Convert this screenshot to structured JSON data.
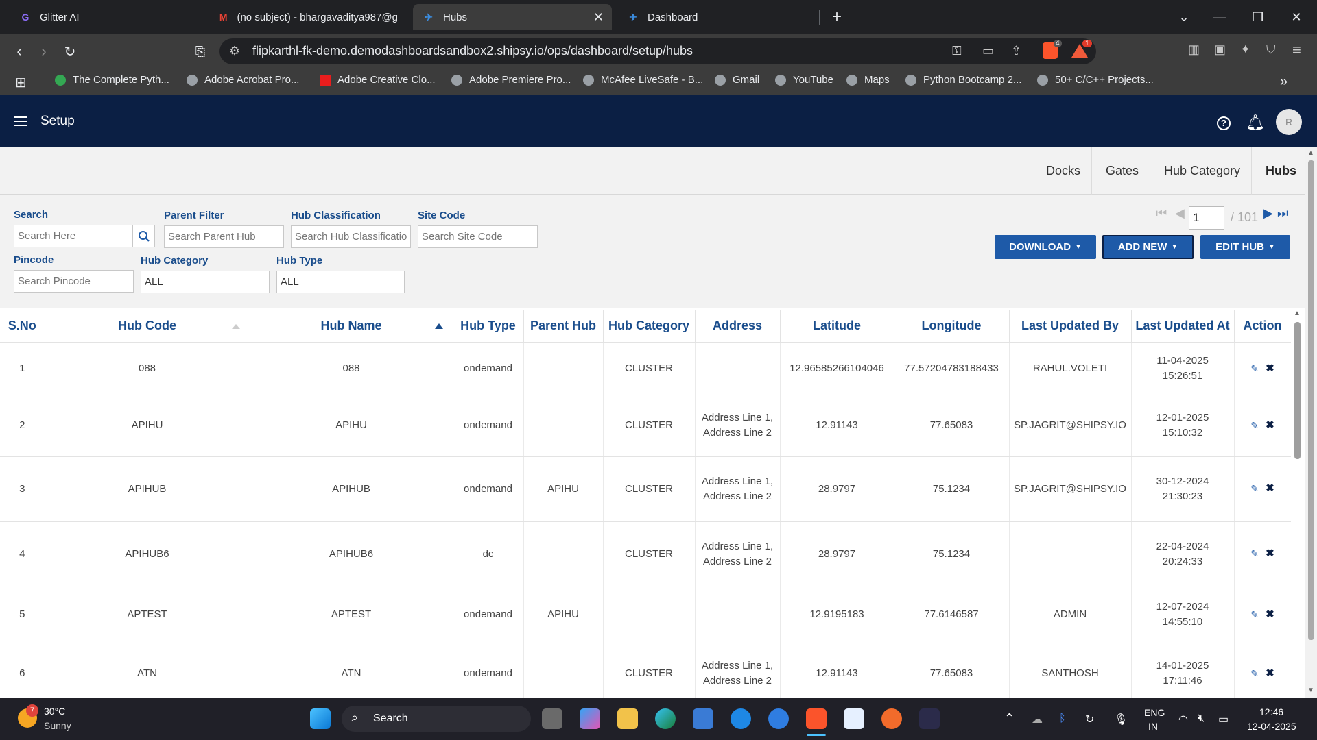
{
  "browser": {
    "tabs": [
      {
        "title": "Glitter AI"
      },
      {
        "title": "(no subject) - bhargavaditya987@g"
      },
      {
        "title": "Hubs"
      },
      {
        "title": "Dashboard"
      }
    ],
    "url": "flipkarthl-fk-demo.demodashboardsandbox2.shipsy.io/ops/dashboard/setup/hubs",
    "brave_badge": "4",
    "alert_badge": "1",
    "bookmarks": [
      "The Complete Pyth...",
      "Adobe Acrobat Pro...",
      "Adobe Creative Clo...",
      "Adobe Premiere Pro...",
      "McAfee LiveSafe - B...",
      "Gmail",
      "YouTube",
      "Maps",
      "Python Bootcamp 2...",
      "50+ C/C++ Projects..."
    ]
  },
  "app": {
    "title": "Setup",
    "avatar_initial": "R",
    "subtabs": [
      "Docks",
      "Gates",
      "Hub Category",
      "Hubs"
    ],
    "active_subtab": "Hubs"
  },
  "filters": {
    "search_label": "Search",
    "search_placeholder": "Search Here",
    "parent_label": "Parent Filter",
    "parent_placeholder": "Search Parent Hub",
    "classification_label": "Hub Classification",
    "classification_placeholder": "Search Hub Classificatio",
    "sitecode_label": "Site Code",
    "sitecode_placeholder": "Search Site Code",
    "pincode_label": "Pincode",
    "pincode_placeholder": "Search Pincode",
    "category_label": "Hub Category",
    "category_value": "ALL",
    "type_label": "Hub Type",
    "type_value": "ALL"
  },
  "pager": {
    "page": "1",
    "total": "/ 101"
  },
  "actions": {
    "download": "DOWNLOAD",
    "add_new": "ADD NEW",
    "edit_hub": "EDIT HUB"
  },
  "table": {
    "columns": [
      "S.No",
      "Hub Code",
      "Hub Name",
      "Hub Type",
      "Parent Hub",
      "Hub Category",
      "Address",
      "Latitude",
      "Longitude",
      "Last Updated By",
      "Last Updated At",
      "Action"
    ],
    "rows": [
      {
        "sno": "1",
        "code": "088",
        "name": "088",
        "type": "ondemand",
        "parent": "",
        "category": "CLUSTER",
        "address": "",
        "lat": "12.96585266104046",
        "lng": "77.57204783188433",
        "by": "RAHUL.VOLETI",
        "date": "11-04-2025",
        "time": "15:26:51"
      },
      {
        "sno": "2",
        "code": "APIHU",
        "name": "APIHU",
        "type": "ondemand",
        "parent": "",
        "category": "CLUSTER",
        "address": "Address Line 1, Address Line 2",
        "lat": "12.91143",
        "lng": "77.65083",
        "by": "SP.JAGRIT@SHIPSY.IO",
        "date": "12-01-2025",
        "time": "15:10:32"
      },
      {
        "sno": "3",
        "code": "APIHUB",
        "name": "APIHUB",
        "type": "ondemand",
        "parent": "APIHU",
        "category": "CLUSTER",
        "address": "Address Line 1, Address Line 2",
        "lat": "28.9797",
        "lng": "75.1234",
        "by": "SP.JAGRIT@SHIPSY.IO",
        "date": "30-12-2024",
        "time": "21:30:23"
      },
      {
        "sno": "4",
        "code": "APIHUB6",
        "name": "APIHUB6",
        "type": "dc",
        "parent": "",
        "category": "CLUSTER",
        "address": "Address Line 1, Address Line 2",
        "lat": "28.9797",
        "lng": "75.1234",
        "by": "",
        "date": "22-04-2024",
        "time": "20:24:33"
      },
      {
        "sno": "5",
        "code": "APTEST",
        "name": "APTEST",
        "type": "ondemand",
        "parent": "APIHU",
        "category": "",
        "address": "",
        "lat": "12.9195183",
        "lng": "77.6146587",
        "by": "ADMIN",
        "date": "12-07-2024",
        "time": "14:55:10"
      },
      {
        "sno": "6",
        "code": "ATN",
        "name": "ATN",
        "type": "ondemand",
        "parent": "",
        "category": "CLUSTER",
        "address": "Address Line 1, Address Line 2",
        "lat": "12.91143",
        "lng": "77.65083",
        "by": "SANTHOSH",
        "date": "14-01-2025",
        "time": "17:11:46"
      }
    ]
  },
  "taskbar": {
    "weather_temp": "30°C",
    "weather_desc": "Sunny",
    "weather_badge": "7",
    "search_label": "Search",
    "lang_top": "ENG",
    "lang_bottom": "IN",
    "time": "12:46",
    "date": "12-04-2025"
  }
}
